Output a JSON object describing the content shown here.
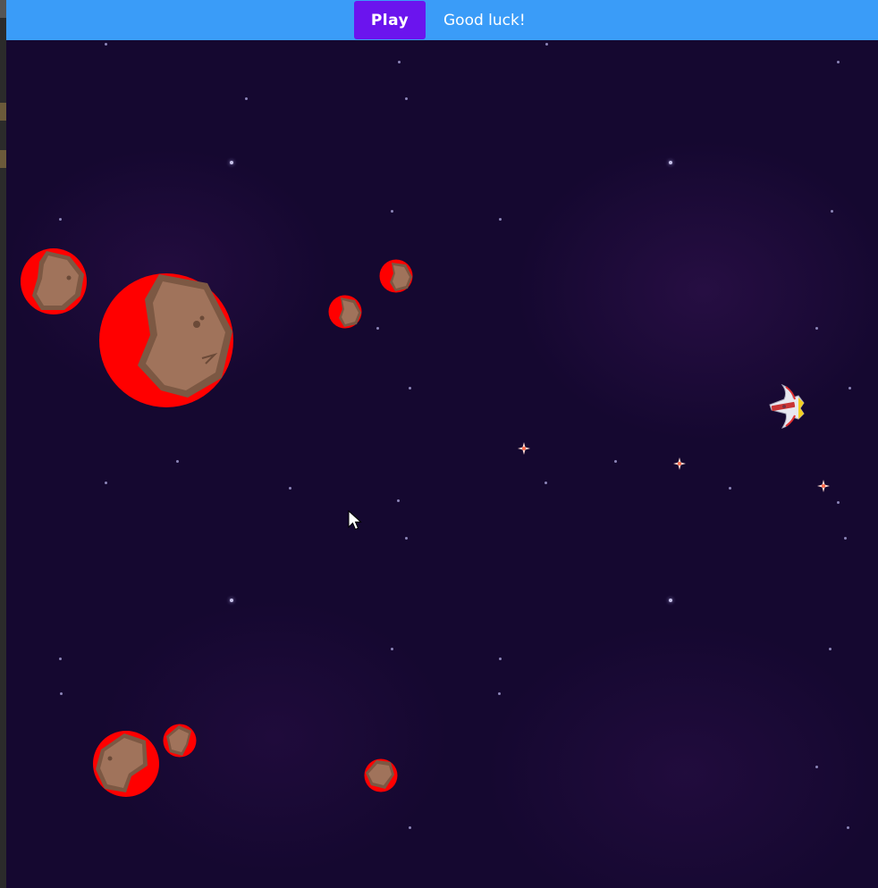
{
  "toolbar": {
    "play_label": "Play",
    "status_text": "Good luck!"
  },
  "colors": {
    "toolbar_bg": "#3a9cf8",
    "play_button_bg": "#6b14ee",
    "space_bg": "#150830",
    "asteroid_hitbox": "#ff0000",
    "asteroid_rock": "#a0735b"
  },
  "icons": {
    "ship": "spaceship-icon",
    "asteroid": "asteroid-icon",
    "bullet": "sparkle-bullet-icon",
    "cursor": "mouse-pointer-icon"
  }
}
